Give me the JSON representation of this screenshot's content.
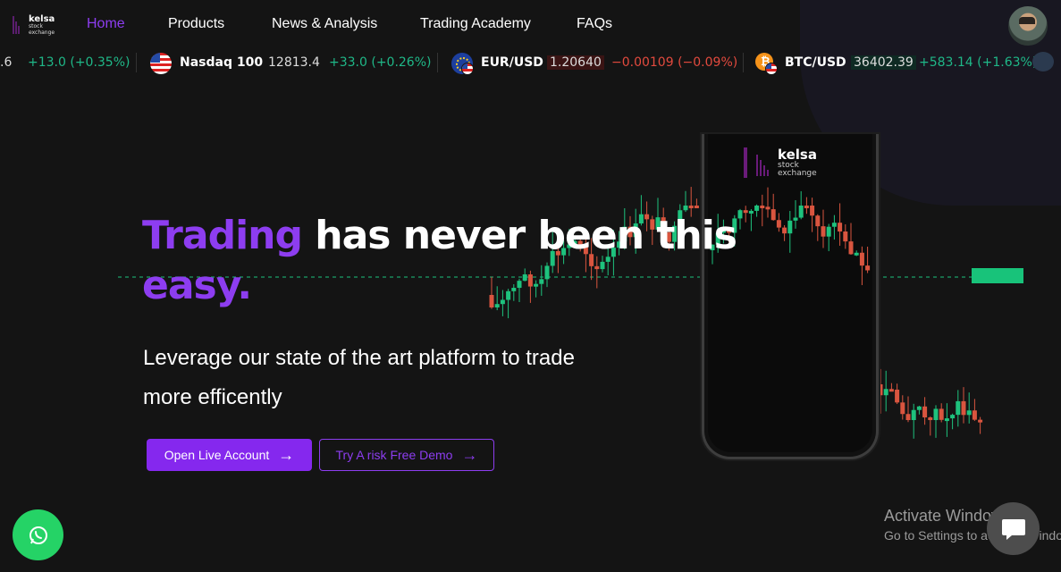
{
  "nav": {
    "logo": {
      "word": "kelsa",
      "sub1": "stock",
      "sub2": "exchange"
    },
    "items": [
      {
        "label": "Home",
        "active": true
      },
      {
        "label": "Products"
      },
      {
        "label": "News & Analysis"
      },
      {
        "label": "Trading Academy"
      },
      {
        "label": "FAQs"
      }
    ],
    "avatar_icon": "user-avatar"
  },
  "ticker": {
    "partial_value": ".6",
    "partial_change": "+13.0 (+0.35%)",
    "items": [
      {
        "name": "Nasdaq 100",
        "price": "12813.4",
        "change": "+33.0 (+0.26%)",
        "direction": "up",
        "flag": "us-flag-icon"
      },
      {
        "name": "EUR/USD",
        "price": "1.20640",
        "change": "−0.00109 (−0.09%)",
        "direction": "down",
        "flag": "eu-flag-icon"
      },
      {
        "name": "BTC/USD",
        "price": "36402.39",
        "change": "+583.14 (+1.63%)",
        "direction": "up",
        "flag": "bitcoin-icon"
      }
    ]
  },
  "hero": {
    "title_highlight": "Trading",
    "title_rest": " has never been this",
    "title_line2": "easy.",
    "subtitle": "Leverage our state of the art platform to trade more efficently",
    "primary_button": "Open Live Account",
    "secondary_button": "Try A risk Free Demo"
  },
  "phone": {
    "word": "kelsa",
    "sub1": "stock",
    "sub2": "exchange"
  },
  "watermark": {
    "line1": "Activate Windows",
    "line2": "Go to Settings to activate Windows."
  },
  "colors": {
    "accent": "#8d3df0",
    "up": "#1fb888",
    "down": "#e34a3e",
    "candle_up": "#1ec27d",
    "candle_down": "#d9553f"
  }
}
